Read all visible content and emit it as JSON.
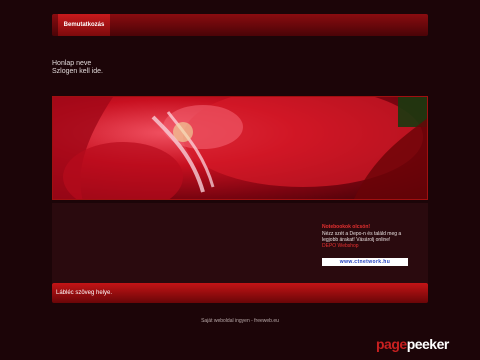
{
  "nav": {
    "items": [
      {
        "label": "Bemutatkozás"
      }
    ]
  },
  "header": {
    "site_name": "Honlap neve",
    "slogan": "Szlogen kell ide."
  },
  "promo": {
    "title": "Notebookok olcsón!",
    "text": "Nézz szét a Depo-n és találd meg a legjobb árakat! Vásárolj online!",
    "link_text": "DEPO Webshop",
    "banner_text": "www.ctnetwork.hu"
  },
  "footer": {
    "text": "Lábléc szöveg helye."
  },
  "credit": {
    "text": "Saját weboldal ingyen - freeweb.eu"
  },
  "watermark": {
    "part1": "page",
    "part2": "peeker"
  },
  "colors": {
    "accent": "#c81a1c",
    "background": "#1c0508",
    "promo_title": "#e63030"
  }
}
